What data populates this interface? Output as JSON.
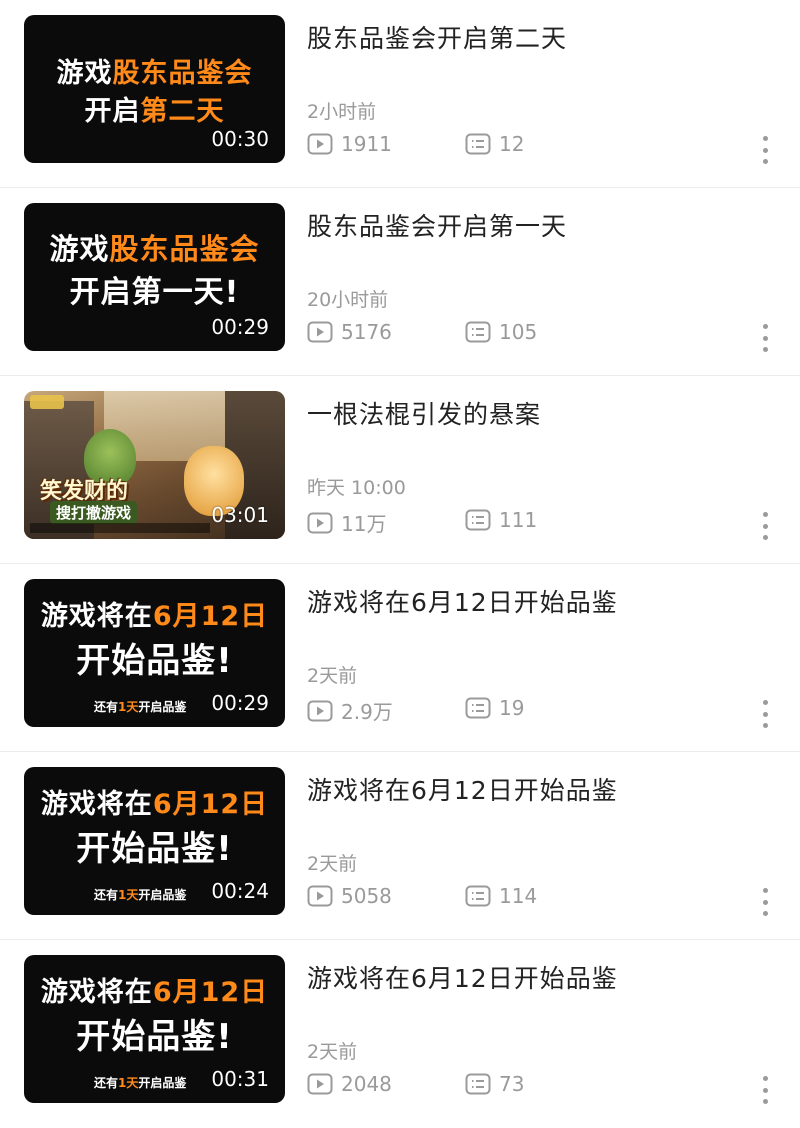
{
  "videos": [
    {
      "title": "股东品鉴会开启第二天",
      "time": "2小时前",
      "plays": "1911",
      "comments": "12",
      "duration": "00:30",
      "thumb": {
        "white1": "游戏",
        "orange1": "股东品鉴会",
        "white2": "开启",
        "orange2": "第二天",
        "tag_a": "",
        "tag_b": "",
        "tag_c": ""
      }
    },
    {
      "title": "股东品鉴会开启第一天",
      "time": "20小时前",
      "plays": "5176",
      "comments": "105",
      "duration": "00:29",
      "thumb": {
        "white1": "游戏",
        "orange1": "股东品鉴会",
        "white2": "开启第一天!",
        "orange2": "",
        "tag_a": "",
        "tag_b": "",
        "tag_c": ""
      }
    },
    {
      "title": "一根法棍引发的悬案",
      "time": "昨天 10:00",
      "plays": "11万",
      "comments": "111",
      "duration": "03:01",
      "thumb": {
        "banner1": "笑发财的",
        "banner2": "搜打撤游戏"
      }
    },
    {
      "title": "游戏将在6月12日开始品鉴",
      "time": "2天前",
      "plays": "2.9万",
      "comments": "19",
      "duration": "00:29",
      "thumb": {
        "white1": "游戏将在",
        "orange1": "6月12日",
        "white2": "开始品鉴!",
        "orange2": "",
        "tag_a": "还有",
        "tag_b": "1天",
        "tag_c": "开启品鉴"
      }
    },
    {
      "title": "游戏将在6月12日开始品鉴",
      "time": "2天前",
      "plays": "5058",
      "comments": "114",
      "duration": "00:24",
      "thumb": {
        "white1": "游戏将在",
        "orange1": "6月12日",
        "white2": "开始品鉴!",
        "orange2": "",
        "tag_a": "还有",
        "tag_b": "1天",
        "tag_c": "开启品鉴"
      }
    },
    {
      "title": "游戏将在6月12日开始品鉴",
      "time": "2天前",
      "plays": "2048",
      "comments": "73",
      "duration": "00:31",
      "thumb": {
        "white1": "游戏将在",
        "orange1": "6月12日",
        "white2": "开始品鉴!",
        "orange2": "",
        "tag_a": "还有",
        "tag_b": "1天",
        "tag_c": "开启品鉴"
      }
    }
  ],
  "icons": {
    "play": "play-count-icon",
    "comment": "comment-count-icon",
    "more": "more-vertical-icon"
  },
  "colors": {
    "accent_orange": "#ff8a1a",
    "meta_gray": "#9a9a9a",
    "thumb_bg": "#0b0b0b"
  }
}
